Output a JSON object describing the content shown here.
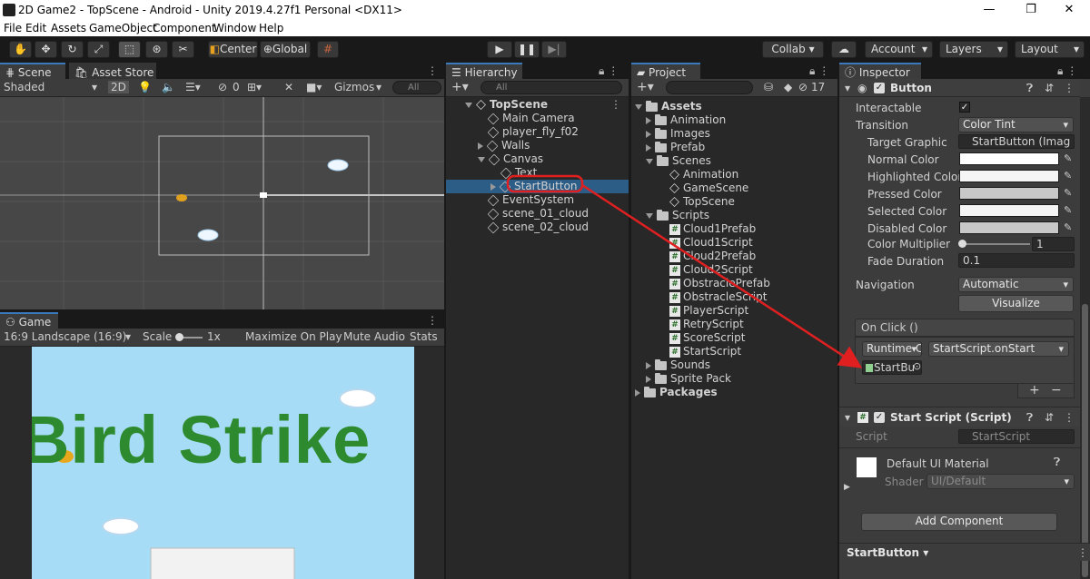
{
  "window": {
    "title": "2D Game2 - TopScene - Android - Unity 2019.4.27f1 Personal <DX11>",
    "controls": [
      "—",
      "❐",
      "✕"
    ]
  },
  "menu": [
    "File",
    "Edit",
    "Assets",
    "GameObject",
    "Component",
    "Window",
    "Help"
  ],
  "toolbar": {
    "pivot": "Center",
    "space": "Global",
    "collab": "Collab ▾",
    "account": "Account",
    "layers": "Layers",
    "layout": "Layout"
  },
  "scene": {
    "tab": "Scene",
    "tab2": "Asset Store",
    "shading": "Shaded",
    "mode2d": "2D",
    "hidden_count": "0",
    "gizmos": "Gizmos",
    "search_placeholder": "All"
  },
  "game": {
    "tab": "Game",
    "aspect": "16:9 Landscape (16:9)",
    "scale_label": "Scale",
    "scale_value": "1x",
    "maximize": "Maximize On Play",
    "mute": "Mute Audio",
    "stats": "Stats",
    "title_text": "Bird Strike",
    "sky_color": "#a7dcf7",
    "title_color": "#2e8a2e"
  },
  "hierarchy": {
    "tab": "Hierarchy",
    "search_placeholder": "All",
    "items": [
      {
        "label": "TopScene",
        "depth": 0,
        "kind": "scene"
      },
      {
        "label": "Main Camera",
        "depth": 1,
        "kind": "object"
      },
      {
        "label": "player_fly_f02",
        "depth": 1,
        "kind": "object"
      },
      {
        "label": "Walls",
        "depth": 1,
        "kind": "object",
        "fold": "closed"
      },
      {
        "label": "Canvas",
        "depth": 1,
        "kind": "object",
        "fold": "open"
      },
      {
        "label": "Text",
        "depth": 2,
        "kind": "object"
      },
      {
        "label": "StartButton",
        "depth": 2,
        "kind": "object",
        "fold": "closed",
        "selected": true
      },
      {
        "label": "EventSystem",
        "depth": 1,
        "kind": "object"
      },
      {
        "label": "scene_01_cloud",
        "depth": 1,
        "kind": "object"
      },
      {
        "label": "scene_02_cloud",
        "depth": 1,
        "kind": "object"
      }
    ]
  },
  "project": {
    "tab": "Project",
    "hidden_count": "17",
    "items": [
      {
        "label": "Assets",
        "depth": 0,
        "kind": "folder",
        "fold": "open",
        "bold": true
      },
      {
        "label": "Animation",
        "depth": 1,
        "kind": "folder",
        "fold": "closed"
      },
      {
        "label": "Images",
        "depth": 1,
        "kind": "folder",
        "fold": "closed"
      },
      {
        "label": "Prefab",
        "depth": 1,
        "kind": "folder",
        "fold": "closed"
      },
      {
        "label": "Scenes",
        "depth": 1,
        "kind": "folder",
        "fold": "open"
      },
      {
        "label": "Animation",
        "depth": 2,
        "kind": "scene"
      },
      {
        "label": "GameScene",
        "depth": 2,
        "kind": "scene"
      },
      {
        "label": "TopScene",
        "depth": 2,
        "kind": "scene"
      },
      {
        "label": "Scripts",
        "depth": 1,
        "kind": "folder",
        "fold": "open"
      },
      {
        "label": "Cloud1Prefab",
        "depth": 2,
        "kind": "script"
      },
      {
        "label": "Cloud1Script",
        "depth": 2,
        "kind": "script"
      },
      {
        "label": "Cloud2Prefab",
        "depth": 2,
        "kind": "script"
      },
      {
        "label": "Cloud2Script",
        "depth": 2,
        "kind": "script"
      },
      {
        "label": "ObstraclePrefab",
        "depth": 2,
        "kind": "script"
      },
      {
        "label": "ObstracleScript",
        "depth": 2,
        "kind": "script"
      },
      {
        "label": "PlayerScript",
        "depth": 2,
        "kind": "script"
      },
      {
        "label": "RetryScript",
        "depth": 2,
        "kind": "script"
      },
      {
        "label": "ScoreScript",
        "depth": 2,
        "kind": "script"
      },
      {
        "label": "StartScript",
        "depth": 2,
        "kind": "script"
      },
      {
        "label": "Sounds",
        "depth": 1,
        "kind": "folder",
        "fold": "closed"
      },
      {
        "label": "Sprite Pack",
        "depth": 1,
        "kind": "folder",
        "fold": "closed"
      },
      {
        "label": "Packages",
        "depth": 0,
        "kind": "folder",
        "fold": "closed",
        "bold": true
      }
    ]
  },
  "inspector": {
    "tab": "Inspector",
    "component": "Button",
    "interactable": "Interactable",
    "transition_label": "Transition",
    "transition_value": "Color Tint",
    "target_graphic_label": "Target Graphic",
    "target_graphic_value": "StartButton (Imag",
    "colors": [
      {
        "label": "Normal Color",
        "value": "#ffffff"
      },
      {
        "label": "Highlighted Color",
        "value": "#f5f5f5"
      },
      {
        "label": "Pressed Color",
        "value": "#c8c8c8"
      },
      {
        "label": "Selected Color",
        "value": "#f5f5f5"
      },
      {
        "label": "Disabled Color",
        "value": "#c8c8c8"
      }
    ],
    "color_multiplier_label": "Color Multiplier",
    "color_multiplier_value": "1",
    "fade_label": "Fade Duration",
    "fade_value": "0.1",
    "navigation_label": "Navigation",
    "navigation_value": "Automatic",
    "visualize": "Visualize",
    "onclick": "On Click ()",
    "runtime": "Runtime C",
    "function": "StartScript.onStart",
    "target_object": "StartBu",
    "plus": "+",
    "minus": "−",
    "script_component": "Start Script (Script)",
    "script_label": "Script",
    "script_value": "StartScript",
    "material": "Default UI Material",
    "shader_label": "Shader",
    "shader_value": "UI/Default",
    "add_component": "Add Component",
    "footer": "StartButton ▾"
  },
  "accent_color": "#e02020",
  "selection_color": "#2c5d87"
}
